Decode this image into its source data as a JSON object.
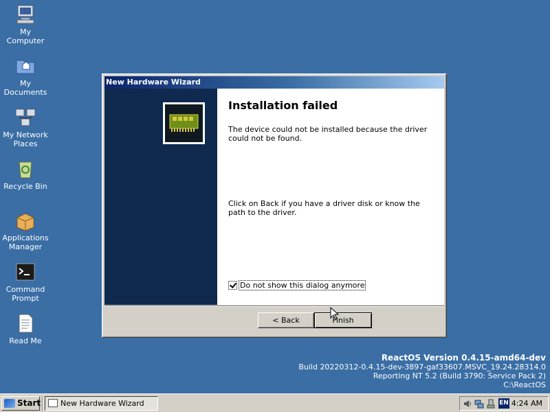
{
  "desktop": {
    "icons": [
      {
        "label": "My Computer"
      },
      {
        "label": "My Documents"
      },
      {
        "label": "My Network Places"
      },
      {
        "label": "Recycle Bin"
      },
      {
        "label": "Applications Manager"
      },
      {
        "label": "Command Prompt"
      },
      {
        "label": "Read Me"
      }
    ]
  },
  "wizard": {
    "title": "New Hardware Wizard",
    "heading": "Installation failed",
    "message_failure": "The device could not be installed because the driver could not be found.",
    "message_hint": "Click on Back if you have a driver disk or know the path to the driver.",
    "checkbox_label": "Do not show this dialog anymore",
    "checkbox_checked": true,
    "back_label": "< Back",
    "finish_label": "Finish"
  },
  "version_info": {
    "title": "ReactOS Version 0.4.15-amd64-dev",
    "build": "Build 20220312-0.4.15-dev-3897-gaf33607.MSVC_19.24.28314.0",
    "reporting": "Reporting NT 5.2 (Build 3790: Service Pack 2)",
    "path": "C:\\ReactOS"
  },
  "taskbar": {
    "start_label": "Start",
    "task_label": "New Hardware Wizard",
    "language": "EN",
    "clock": "4:24 AM"
  },
  "colors": {
    "desktop": "#3a6ea5",
    "wizard_side_panel": "#0f2a4e",
    "titlebar_start": "#0a246a"
  }
}
